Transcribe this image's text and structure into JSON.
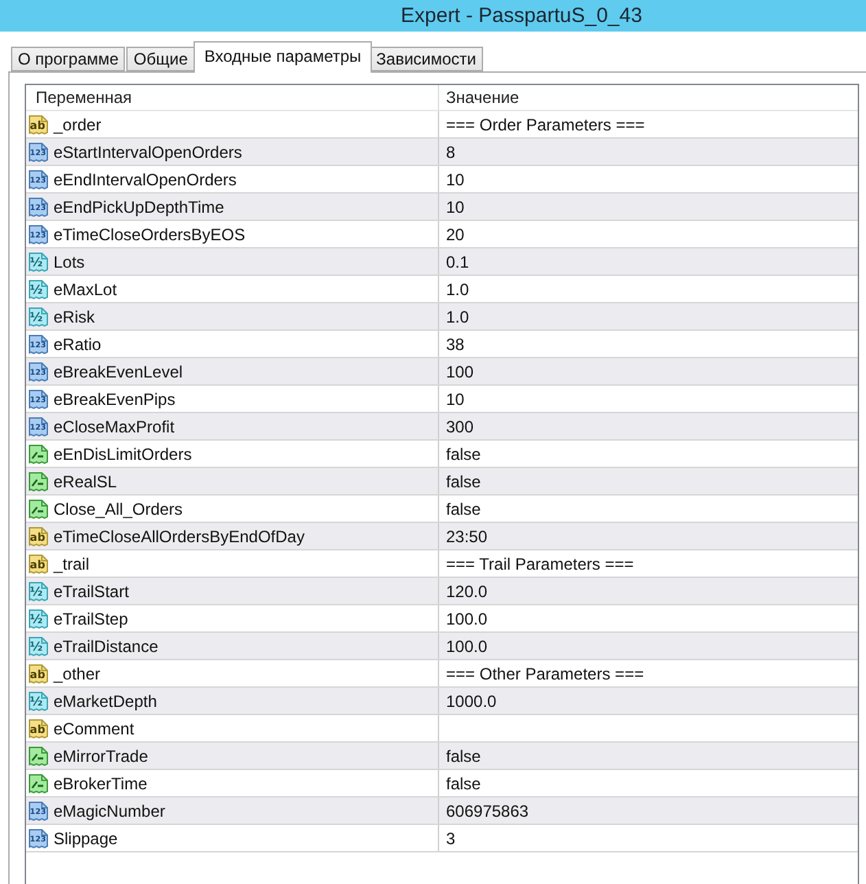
{
  "window": {
    "title": "Expert - PasspartuS_0_43"
  },
  "tabs": [
    {
      "label": "О программе",
      "selected": false
    },
    {
      "label": "Общие",
      "selected": false
    },
    {
      "label": "Входные параметры",
      "selected": true
    },
    {
      "label": "Зависимости",
      "selected": false
    }
  ],
  "table": {
    "columns": [
      "Переменная",
      "Значение"
    ],
    "rows": [
      {
        "kind": "string",
        "icon_text": "ab",
        "name": "_order",
        "value": "=== Order Parameters ==="
      },
      {
        "kind": "int",
        "icon_text": "123",
        "name": "eStartIntervalOpenOrders",
        "value": "8"
      },
      {
        "kind": "int",
        "icon_text": "123",
        "name": "eEndIntervalOpenOrders",
        "value": "10"
      },
      {
        "kind": "int",
        "icon_text": "123",
        "name": "eEndPickUpDepthTime",
        "value": "10"
      },
      {
        "kind": "int",
        "icon_text": "123",
        "name": "eTimeCloseOrdersByEOS",
        "value": "20"
      },
      {
        "kind": "double",
        "icon_text": "½",
        "name": "Lots",
        "value": "0.1"
      },
      {
        "kind": "double",
        "icon_text": "½",
        "name": "eMaxLot",
        "value": "1.0"
      },
      {
        "kind": "double",
        "icon_text": "½",
        "name": "eRisk",
        "value": "1.0"
      },
      {
        "kind": "int",
        "icon_text": "123",
        "name": "eRatio",
        "value": "38"
      },
      {
        "kind": "int",
        "icon_text": "123",
        "name": "eBreakEvenLevel",
        "value": "100"
      },
      {
        "kind": "int",
        "icon_text": "123",
        "name": "eBreakEvenPips",
        "value": "10"
      },
      {
        "kind": "int",
        "icon_text": "123",
        "name": "eCloseMaxProfit",
        "value": "300"
      },
      {
        "kind": "bool",
        "name": "eEnDisLimitOrders",
        "value": "false"
      },
      {
        "kind": "bool",
        "name": "eRealSL",
        "value": "false"
      },
      {
        "kind": "bool",
        "name": "Close_All_Orders",
        "value": "false"
      },
      {
        "kind": "string",
        "icon_text": "ab",
        "name": "eTimeCloseAllOrdersByEndOfDay",
        "value": "23:50"
      },
      {
        "kind": "string",
        "icon_text": "ab",
        "name": "_trail",
        "value": "=== Trail Parameters ==="
      },
      {
        "kind": "double",
        "icon_text": "½",
        "name": "eTrailStart",
        "value": "120.0"
      },
      {
        "kind": "double",
        "icon_text": "½",
        "name": "eTrailStep",
        "value": "100.0"
      },
      {
        "kind": "double",
        "icon_text": "½",
        "name": "eTrailDistance",
        "value": "100.0"
      },
      {
        "kind": "string",
        "icon_text": "ab",
        "name": "_other",
        "value": "=== Other Parameters ==="
      },
      {
        "kind": "double",
        "icon_text": "½",
        "name": "eMarketDepth",
        "value": "1000.0"
      },
      {
        "kind": "string",
        "icon_text": "ab",
        "name": "eComment"
      },
      {
        "kind": "bool",
        "name": "eMirrorTrade",
        "value": "false"
      },
      {
        "kind": "bool",
        "name": "eBrokerTime",
        "value": "false"
      },
      {
        "kind": "int",
        "icon_text": "123",
        "name": "eMagicNumber",
        "value": "606975863"
      },
      {
        "kind": "int",
        "icon_text": "123",
        "name": "Slippage",
        "value": "3"
      }
    ]
  }
}
